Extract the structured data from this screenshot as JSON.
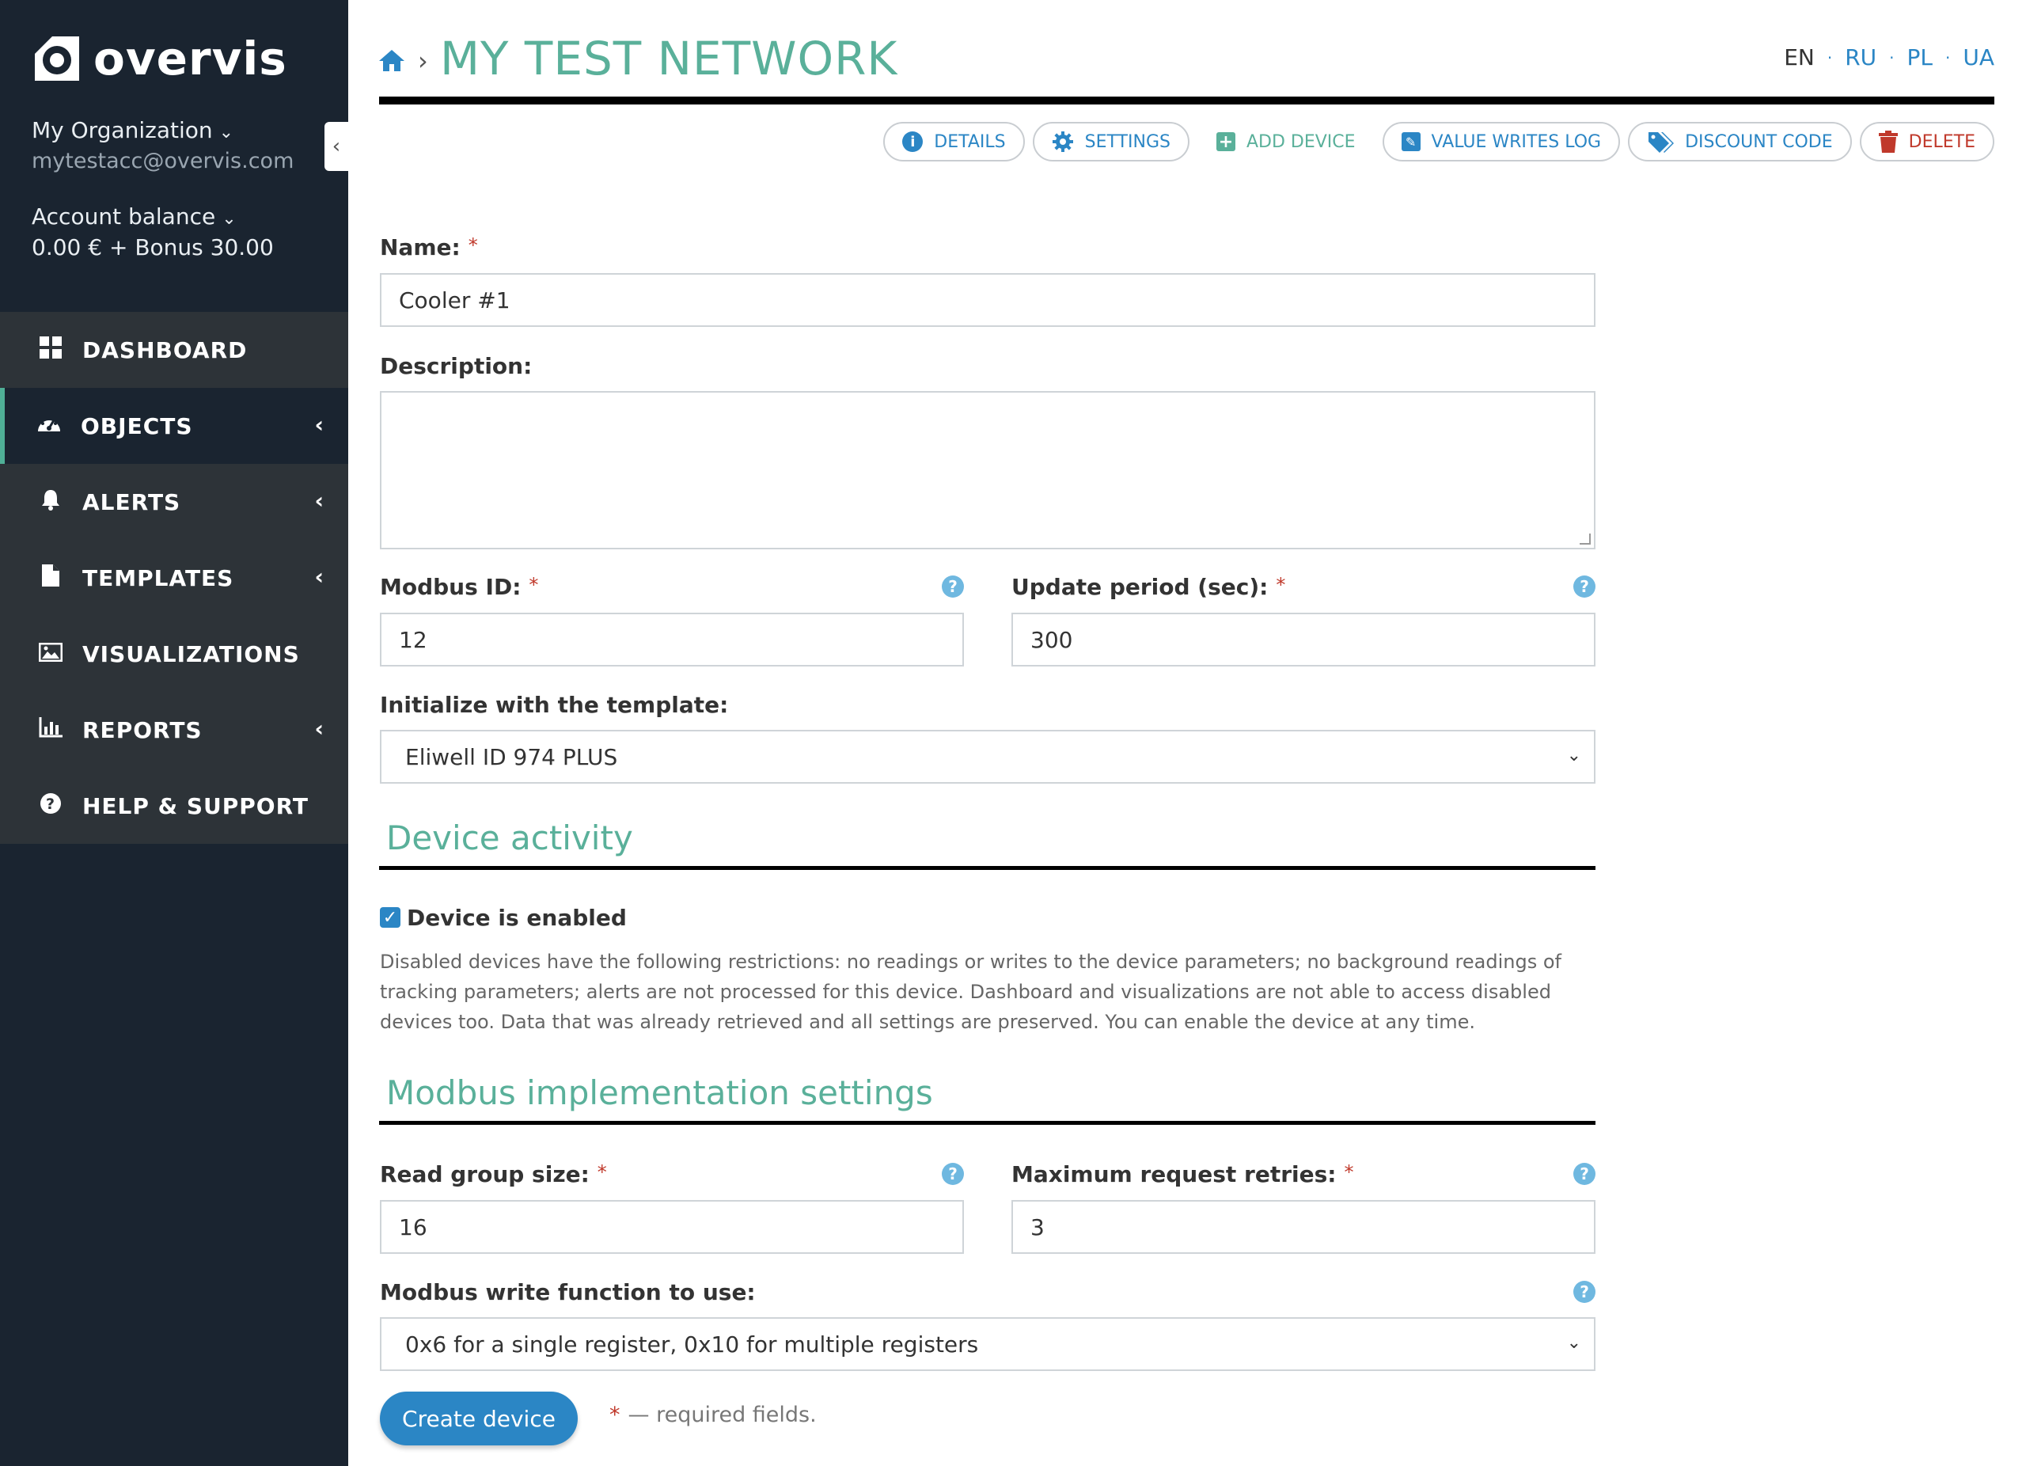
{
  "sidebar": {
    "logo_text": "overvis",
    "org_name": "My Organization",
    "email": "mytestacc@overvis.com",
    "balance_label": "Account balance",
    "balance_value": "0.00 € + Bonus 30.00",
    "nav": [
      {
        "label": "DASHBOARD",
        "icon": "grid-icon",
        "active": false,
        "has_submenu": false
      },
      {
        "label": "OBJECTS",
        "icon": "gauge-icon",
        "active": true,
        "has_submenu": true
      },
      {
        "label": "ALERTS",
        "icon": "bell-icon",
        "active": false,
        "has_submenu": true
      },
      {
        "label": "TEMPLATES",
        "icon": "file-icon",
        "active": false,
        "has_submenu": true
      },
      {
        "label": "VISUALIZATIONS",
        "icon": "image-icon",
        "active": false,
        "has_submenu": false
      },
      {
        "label": "REPORTS",
        "icon": "bar-chart-icon",
        "active": false,
        "has_submenu": true
      },
      {
        "label": "HELP & SUPPORT",
        "icon": "question-icon",
        "active": false,
        "has_submenu": false
      }
    ]
  },
  "header": {
    "breadcrumb_sep": "›",
    "title": "MY TEST NETWORK",
    "languages": {
      "current": "EN",
      "others": [
        "RU",
        "PL",
        "UA"
      ],
      "separator": "·"
    }
  },
  "toolbar": {
    "details": "DETAILS",
    "settings": "SETTINGS",
    "add_device": "ADD DEVICE",
    "value_writes_log": "VALUE WRITES LOG",
    "discount_code": "DISCOUNT CODE",
    "delete": "DELETE"
  },
  "form": {
    "name_label": "Name:",
    "name_value": "Cooler #1",
    "description_label": "Description:",
    "description_value": "",
    "modbus_id_label": "Modbus ID:",
    "modbus_id_value": "12",
    "update_period_label": "Update period (sec):",
    "update_period_value": "300",
    "template_label": "Initialize with the template:",
    "template_value": "Eliwell ID 974 PLUS",
    "device_activity_title": "Device activity",
    "device_enabled_label": "Device is enabled",
    "device_enabled": true,
    "device_enabled_note": "Disabled devices have the following restrictions: no readings or writes to the device parameters; no background readings of tracking parameters; alerts are not processed for this device. Dashboard and visualizations are not able to access disabled devices too. Data that was already retrieved and all settings are preserved. You can enable the device at any time.",
    "modbus_section_title": "Modbus implementation settings",
    "read_group_label": "Read group size:",
    "read_group_value": "16",
    "max_retries_label": "Maximum request retries:",
    "max_retries_value": "3",
    "write_function_label": "Modbus write function to use:",
    "write_function_value": "0x6 for a single register, 0x10 for multiple registers",
    "required_star": "*",
    "submit_label": "Create device",
    "required_note": "— required fields."
  },
  "colors": {
    "sidebar_bg": "#1a2430",
    "nav_bg": "#2d3338",
    "accent_green": "#5ab09a",
    "link_blue": "#2b86c5",
    "danger_red": "#c0392b"
  }
}
